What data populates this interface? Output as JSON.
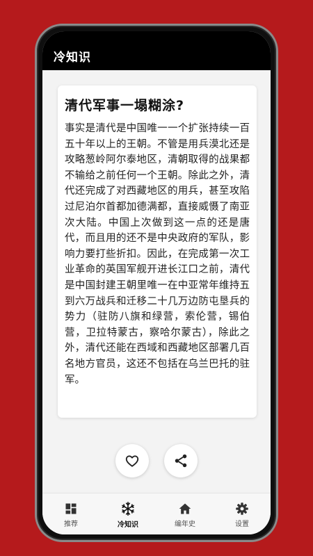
{
  "app": {
    "title": "冷知识"
  },
  "card": {
    "title": "清代军事一塌糊涂?",
    "body": "事实是清代是中国唯一一个扩张持续一百五十年以上的王朝。不管是用兵漠北还是攻略葱岭阿尔泰地区，清朝取得的战果都不输给之前任何一个王朝。除此之外，清代还完成了对西藏地区的用兵，甚至攻陷过尼泊尔首都加德满都，直接威慑了南亚次大陆。中国上次做到这一点的还是唐代，而且用的还不是中央政府的军队，影响力要打些折扣。因此，在完成第一次工业革命的英国军舰开进长江口之前，清代是中国封建王朝里唯一在中亚常年维持五到六万战兵和迁移二十几万边防屯垦兵的势力（驻防八旗和绿营，索伦营，锡伯营，卫拉特蒙古，察哈尔蒙古），除此之外，清代还能在西域和西藏地区部署几百名地方官员，这还不包括在乌兰巴托的驻军。"
  },
  "actions": {
    "like_icon": "heart-icon",
    "share_icon": "share-icon"
  },
  "nav": {
    "items": [
      {
        "label": "推荐",
        "icon": "dashboard-icon"
      },
      {
        "label": "冷知识",
        "icon": "snowflake-icon",
        "active": true
      },
      {
        "label": "编年史",
        "icon": "home-icon"
      },
      {
        "label": "设置",
        "icon": "gear-icon"
      }
    ]
  },
  "colors": {
    "background": "#b51a1c",
    "appbar": "#000000",
    "icon": "#333333"
  }
}
